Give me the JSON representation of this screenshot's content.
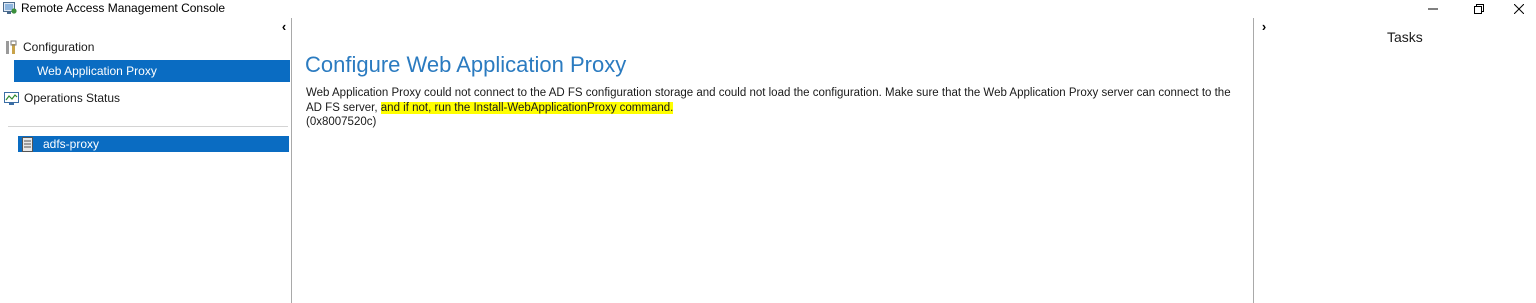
{
  "window": {
    "title": "Remote Access Management Console",
    "icon": "remote-access-console-icon",
    "controls": {
      "minimize": "minimize-icon",
      "maximize": "restore-icon",
      "close": "close-icon"
    }
  },
  "left_pane": {
    "collapse_glyph": "‹",
    "configuration_label": "Configuration",
    "configuration_icon": "tools-icon",
    "selected_item_label": "Web Application Proxy",
    "operations_status_label": "Operations Status",
    "operations_status_icon": "monitor-chart-icon",
    "server": {
      "name": "adfs-proxy",
      "icon": "server-icon"
    }
  },
  "main": {
    "title": "Configure Web Application Proxy",
    "message_part1": "Web Application Proxy could not connect to the AD FS configuration storage and could not load the configuration. Make sure that the Web Application Proxy server can connect to the AD FS server, ",
    "message_highlighted": "and if not, run the Install-WebApplicationProxy command.",
    "error_code": "(0x8007520c)"
  },
  "right_pane": {
    "expand_glyph": "›",
    "tasks_title": "Tasks"
  },
  "colors": {
    "selection": "#0a6cc2",
    "title_blue": "#2b7bc0",
    "highlight": "#ffff00"
  }
}
